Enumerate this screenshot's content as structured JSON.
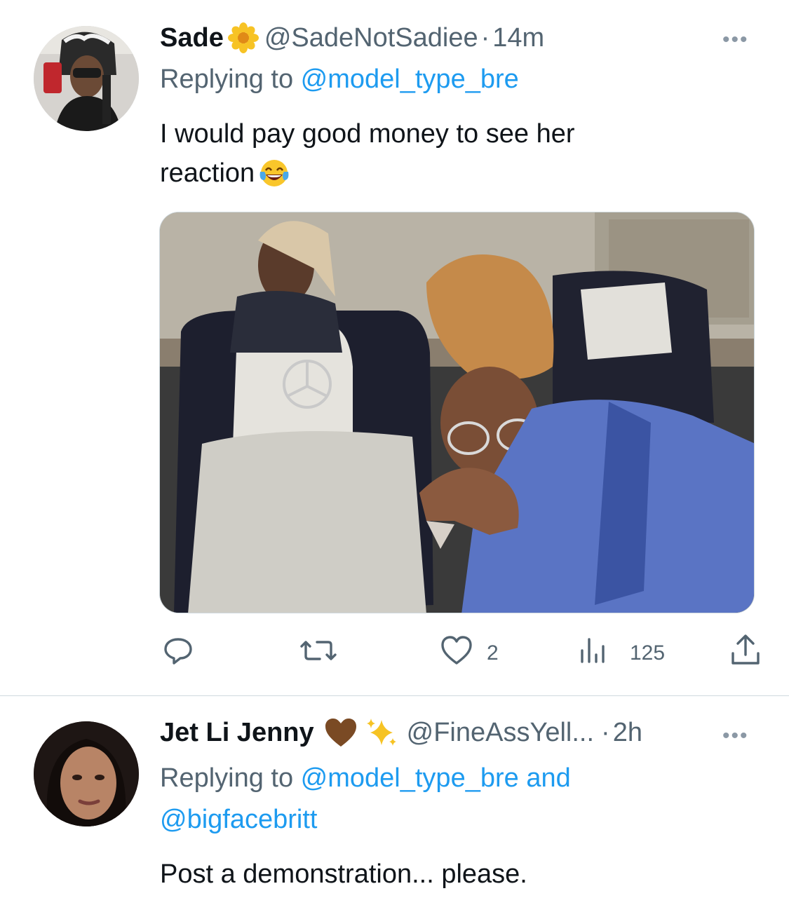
{
  "tweets": [
    {
      "display_name": "Sade",
      "name_emoji": "sunflower",
      "handle": "@SadeNotSadiee",
      "separator": "·",
      "time": "14m",
      "replying_prefix": "Replying to ",
      "replying_to": "@model_type_bre",
      "text_line1": "I would pay good money to see her",
      "text_line2": "reaction",
      "text_emoji": "face-with-tears-of-joy",
      "more": "•••",
      "media_image": "crying-woman-on-bus-photo",
      "actions": {
        "reply_count": "",
        "retweet_count": "",
        "like_count": "2",
        "views_count": "125"
      }
    },
    {
      "display_name": "Jet Li Jenny",
      "name_emoji_1": "brown-heart",
      "name_emoji_2": "sparkles",
      "handle": "@FineAssYell...",
      "separator": "·",
      "time": "2h",
      "replying_prefix": "Replying to ",
      "replying_to": "@model_type_bre",
      "replying_and": " and",
      "replying_to_2": "@bigfacebritt",
      "text": "Post a demonstration... please.",
      "more": "•••"
    }
  ],
  "colors": {
    "text_primary": "#0f1419",
    "text_secondary": "#536471",
    "link": "#1d9bf0",
    "divider": "#cfd9de"
  }
}
